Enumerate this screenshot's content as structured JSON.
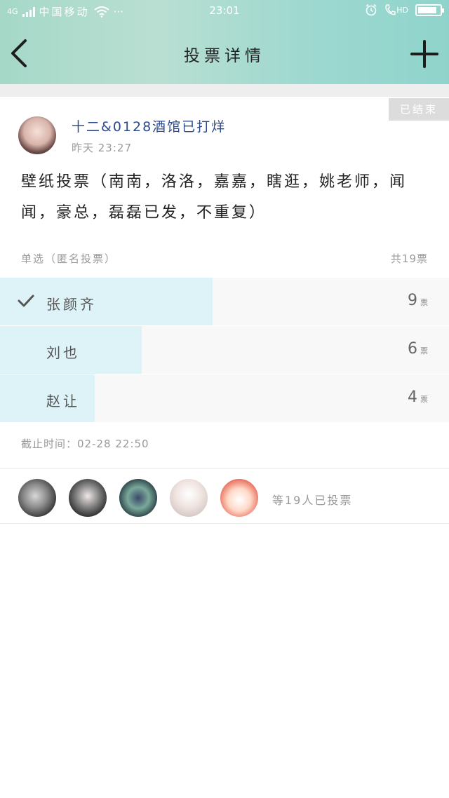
{
  "status_bar": {
    "signal_label": "4G",
    "carrier": "中国移动",
    "extra": "···",
    "time": "23:01",
    "hd_label": "HD"
  },
  "header": {
    "title": "投票详情",
    "back_icon": "chevron-left-icon",
    "add_icon": "plus-icon"
  },
  "post": {
    "status_tag": "已结束",
    "author": "十二&0128酒馆已打烊",
    "time": "昨天 23:27",
    "question": "壁纸投票（南南，洛洛，嘉嘉，瞎逛，姚老师，闻闻，豪总，磊磊已发，不重复）"
  },
  "vote": {
    "mode": "单选（匿名投票）",
    "total": "共19票",
    "options": [
      {
        "name": "张颜齐",
        "count": "9",
        "unit": "票",
        "share": 0.474,
        "selected": true
      },
      {
        "name": "刘也",
        "count": "6",
        "unit": "票",
        "share": 0.316,
        "selected": false
      },
      {
        "name": "赵让",
        "count": "4",
        "unit": "票",
        "share": 0.211,
        "selected": false
      }
    ],
    "deadline": "截止时间：02-28 22:50"
  },
  "voters": {
    "count_label": "等19人已投票"
  },
  "colors": {
    "header_gradient_start": "#a5d8c8",
    "header_gradient_end": "#8fd4cc",
    "bar_fill": "#def3f8",
    "author_color": "#2c4a8c",
    "ended_tag_bg": "#dcdcdc"
  }
}
